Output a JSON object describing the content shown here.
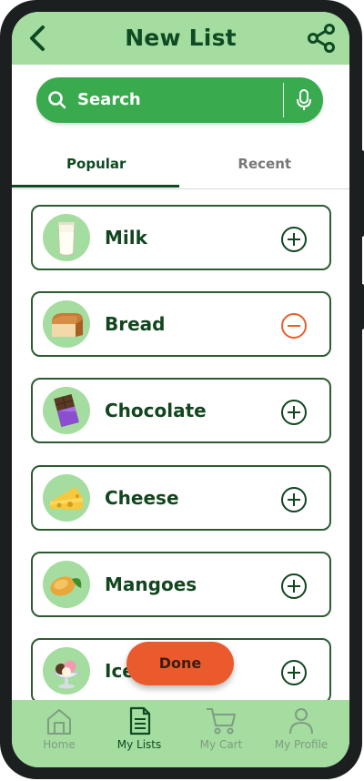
{
  "header": {
    "title": "New List",
    "back_icon": "back-arrow-icon",
    "share_icon": "share-icon"
  },
  "search": {
    "placeholder": "Search",
    "mic_icon": "microphone-icon"
  },
  "tabs": [
    {
      "label": "Popular",
      "active": true
    },
    {
      "label": "Recent",
      "active": false
    }
  ],
  "items": [
    {
      "label": "Milk",
      "icon": "milk-icon",
      "action": "add"
    },
    {
      "label": "Bread",
      "icon": "bread-icon",
      "action": "remove"
    },
    {
      "label": "Chocolate",
      "icon": "chocolate-icon",
      "action": "add"
    },
    {
      "label": "Cheese",
      "icon": "cheese-icon",
      "action": "add"
    },
    {
      "label": "Mangoes",
      "icon": "mango-icon",
      "action": "add"
    },
    {
      "label": "Ice",
      "icon": "ice-cream-icon",
      "action": "add"
    }
  ],
  "done_button": {
    "label": "Done"
  },
  "bottom_nav": [
    {
      "label": "Home",
      "icon": "home-icon",
      "active": false
    },
    {
      "label": "My Lists",
      "icon": "list-icon",
      "active": true
    },
    {
      "label": "My Cart",
      "icon": "cart-icon",
      "active": false
    },
    {
      "label": "My Profile",
      "icon": "profile-icon",
      "active": false
    }
  ],
  "colors": {
    "header_bg": "#a5dca0",
    "primary": "#3aaa4e",
    "dark_green": "#0e4a22",
    "accent_orange": "#ea5a2d"
  }
}
